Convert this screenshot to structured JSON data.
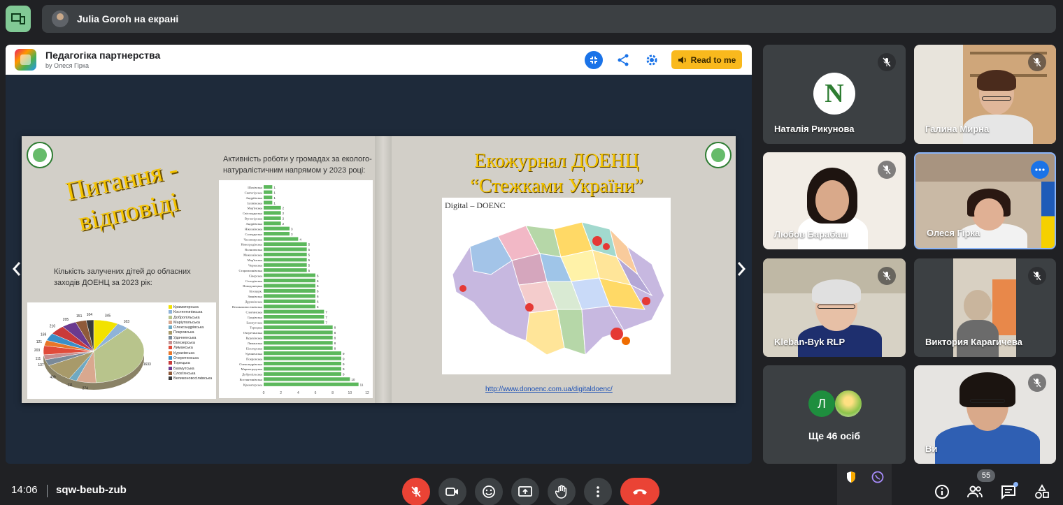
{
  "presenting": {
    "text": "Julia Goroh на екрані"
  },
  "book": {
    "title": "Педагогіка партнерства",
    "author": "by Олеся Гірка",
    "read_label": "Read to me"
  },
  "slide_left": {
    "title_line1": "Питання -",
    "title_line2": "відповіді",
    "pie_caption": "Кількість залучених дітей до обласних заходів ДОЕНЦ за 2023 рік:",
    "bar_caption": "Активність роботи у громадах за еколого-натуралістичним напрямом у 2023 році:"
  },
  "slide_right": {
    "title_line1": "Екожурнал ДОЕНЦ",
    "title_line2": "“Стежками України”",
    "map_label": "Digital – DOENC",
    "link": "http://www.donoenc.com.ua/digitaldoenc/"
  },
  "chart_data": [
    {
      "type": "pie",
      "title": "",
      "values": [
        345,
        163,
        1633,
        274,
        111,
        409,
        137,
        111,
        203,
        121,
        169,
        210,
        205,
        151,
        104
      ],
      "legend": [
        "Краматорська",
        "Костянтинівська",
        "Добропільська",
        "Маріупольська",
        "Олександрівська",
        "Покровська",
        "Удачненська",
        "Білозерська",
        "Лиманська",
        "Курахівська",
        "Очеретинська",
        "Торецька",
        "Бахмутська",
        "Слов'янська",
        "Великоновосілківська"
      ],
      "colors": [
        "#f2e200",
        "#8fb3d9",
        "#b8c48c",
        "#d9a88f",
        "#6fa9c2",
        "#a89a6a",
        "#7a8a99",
        "#c78f8f",
        "#e04b3a",
        "#e8762a",
        "#3a8fc9",
        "#c93a3a",
        "#6b3a8f",
        "#8f5a3a",
        "#3a3a3a"
      ]
    },
    {
      "type": "bar",
      "title": "",
      "categories": [
        "Шахівська",
        "Святогірська",
        "Андріївська",
        "Іллінівська",
        "Мар'їнська",
        "Світлодарська",
        "Вуглегірська",
        "Андріївська",
        "Ніколаївська",
        "Соледарська",
        "Часовоярська",
        "Новогродівська",
        "Волноваська",
        "Миколаївська",
        "Мар'їнська",
        "Черкаська",
        "Старомлинівська",
        "Сіверська",
        "Селидівська",
        "Новодонецька",
        "Білоцерк.",
        "Званівська",
        "Дружківська",
        "Великоновосілківська",
        "Слов'янська",
        "Гродівська",
        "Бахмутська",
        "Торецька",
        "Очеретинська",
        "Курахівська",
        "Лиманська",
        "Білозерська",
        "Удачненська",
        "Покровська",
        "Олександрівська",
        "Мирноградська",
        "Добропільська",
        "Костянтинівська",
        "Краматорська"
      ],
      "values": [
        1,
        1,
        1,
        1,
        2,
        2,
        2,
        2,
        3,
        3,
        4,
        5,
        5,
        5,
        5,
        5,
        5,
        6,
        6,
        6,
        6,
        6,
        6,
        6,
        7,
        7,
        7,
        8,
        8,
        8,
        8,
        8,
        9,
        9,
        9,
        9,
        9,
        10,
        11
      ],
      "xlim": [
        0,
        12
      ],
      "xticks": [
        0,
        2,
        4,
        6,
        8,
        10,
        12
      ],
      "color": "#5cb85c"
    }
  ],
  "participants": [
    {
      "name": "Наталія Рикунова",
      "avatar_letter": "N"
    },
    {
      "name": "Галина Мирна"
    },
    {
      "name": "Любов Барабаш"
    },
    {
      "name": "Олеся Гірка"
    },
    {
      "name": "Kleban-Byk RLP"
    },
    {
      "name": "Виктория Карагичева"
    },
    {
      "name": "Ще 46 осіб",
      "avatar_letter": "Л"
    },
    {
      "name": "Ви"
    }
  ],
  "bottom": {
    "time": "14:06",
    "meeting_code": "sqw-beub-zub",
    "people_count": "55"
  }
}
